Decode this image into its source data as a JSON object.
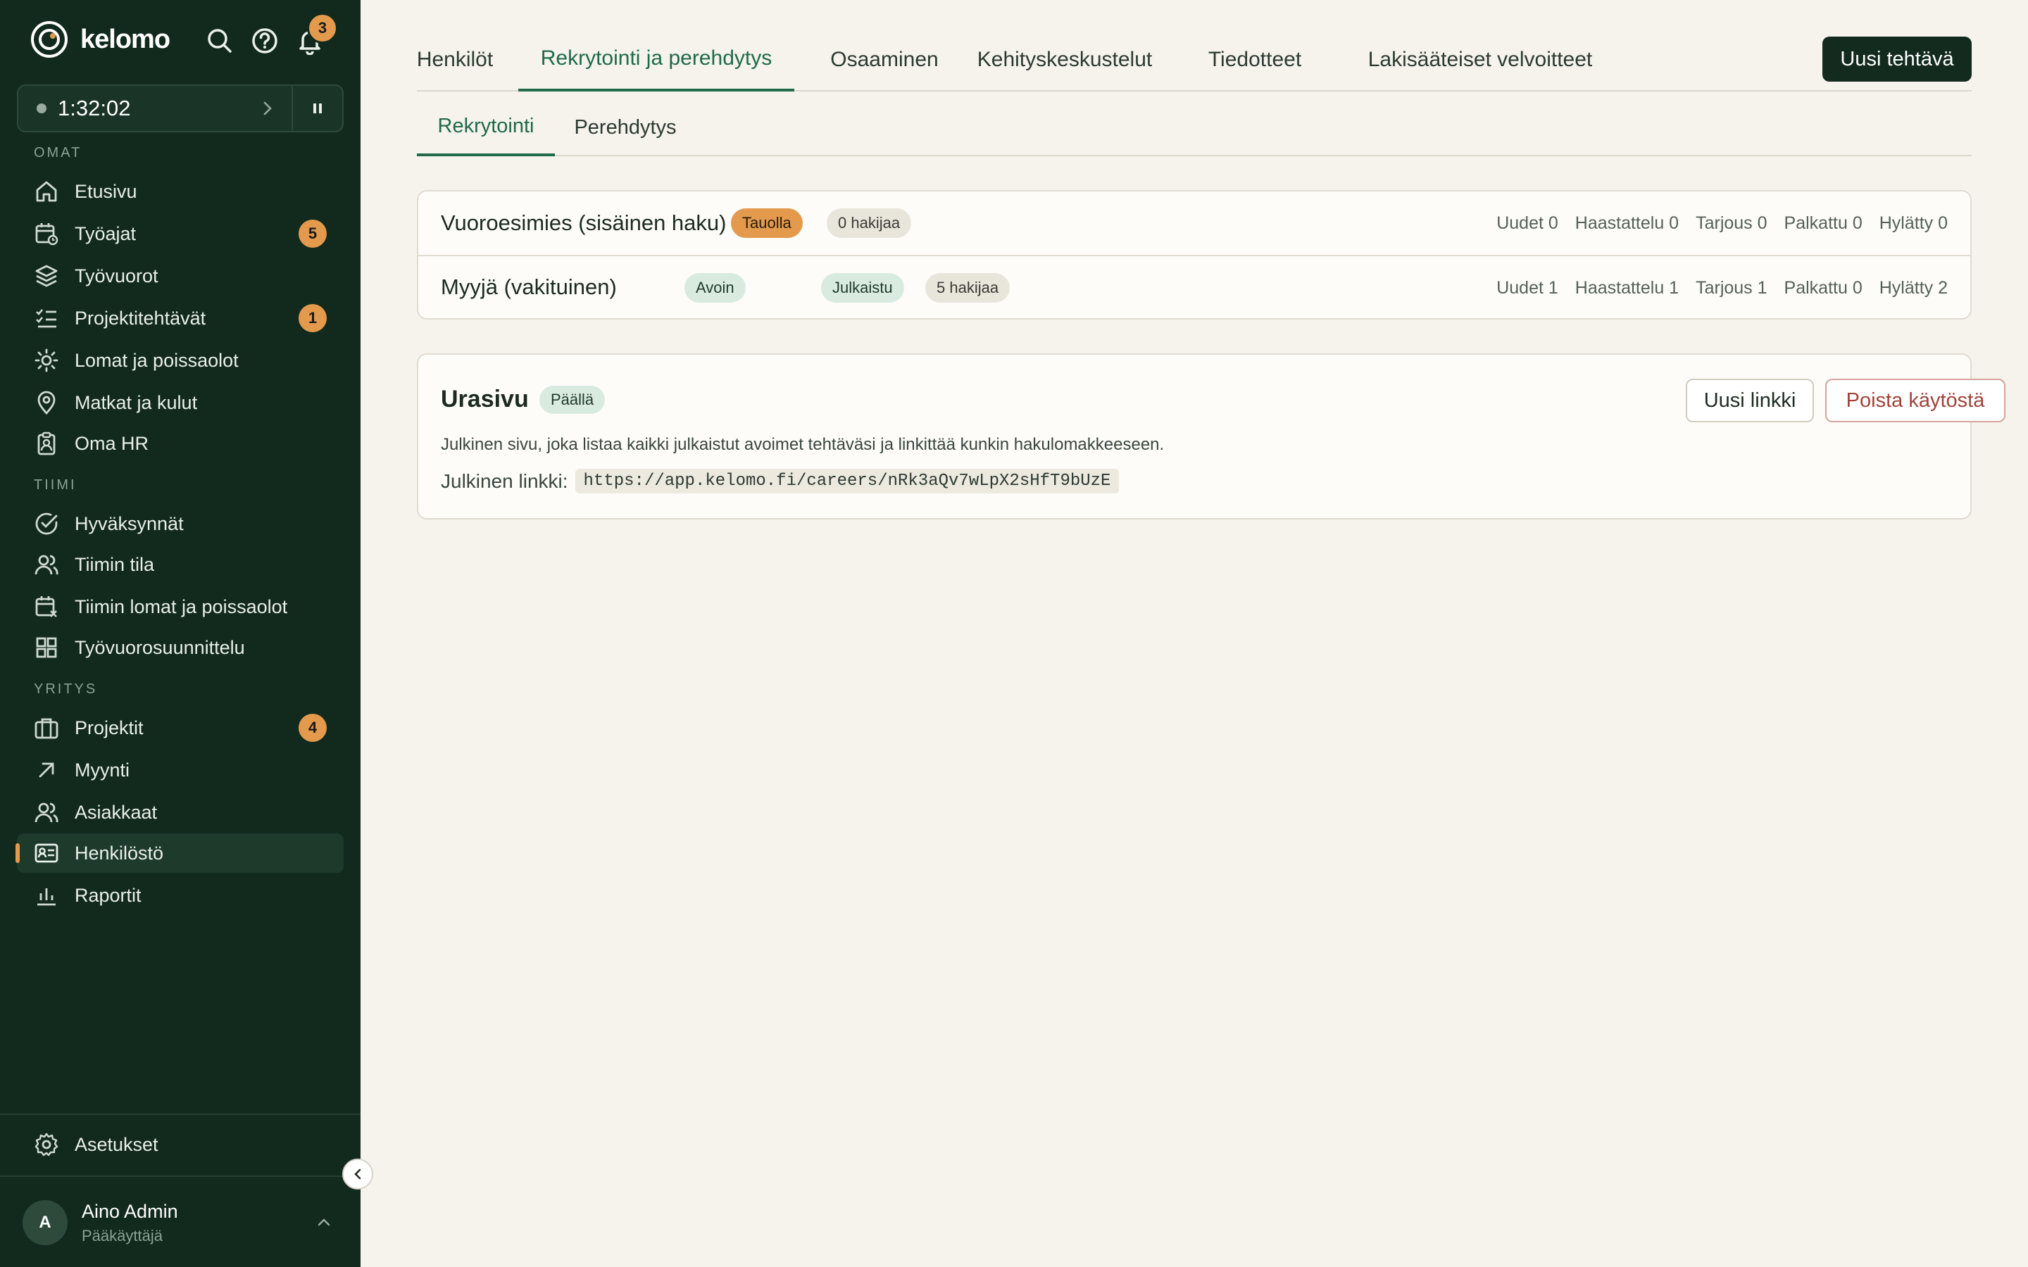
{
  "brand": {
    "name": "kelomo"
  },
  "header_icons": {
    "search": "search-icon",
    "help": "help-icon",
    "notifications": "bell-icon",
    "notification_count": "3"
  },
  "timer": {
    "time": "1:32:02"
  },
  "sections": {
    "omat": "OMAT",
    "tiimi": "TIIMI",
    "yritys": "YRITYS"
  },
  "nav": {
    "etusivu": "Etusivu",
    "tyoajat": "Työajat",
    "tyoajat_badge": "5",
    "tyovuorot": "Työvuorot",
    "projektitehtavat": "Projektitehtävät",
    "projektitehtavat_badge": "1",
    "lomat": "Lomat ja poissaolot",
    "matkat": "Matkat ja kulut",
    "omahr": "Oma HR",
    "hyvaksynnat": "Hyväksynnät",
    "tiimin_tila": "Tiimin tila",
    "tiimin_lomat": "Tiimin lomat ja poissaolot",
    "tyovuorosuunnittelu": "Työvuorosuunnittelu",
    "projektit": "Projektit",
    "projektit_badge": "4",
    "myynti": "Myynti",
    "asiakkaat": "Asiakkaat",
    "henkilosto": "Henkilöstö",
    "raportit": "Raportit",
    "asetukset": "Asetukset"
  },
  "user": {
    "initial": "A",
    "name": "Aino Admin",
    "role": "Pääkäyttäjä"
  },
  "tabs": [
    {
      "label": "Henkilöt"
    },
    {
      "label": "Rekrytointi ja perehdytys"
    },
    {
      "label": "Osaaminen"
    },
    {
      "label": "Kehityskeskustelut"
    },
    {
      "label": "Tiedotteet"
    },
    {
      "label": "Lakisääteiset velvoitteet"
    }
  ],
  "primary_action": "Uusi tehtävä",
  "subtabs": [
    {
      "label": "Rekrytointi"
    },
    {
      "label": "Perehdytys"
    }
  ],
  "jobs": [
    {
      "title": "Vuoroesimies (sisäinen haku)",
      "status": "Tauolla",
      "applicants": "0 hakijaa",
      "stats": [
        "Uudet 0",
        "Haastattelu 0",
        "Tarjous 0",
        "Palkattu 0",
        "Hylätty 0"
      ]
    },
    {
      "title": "Myyjä (vakituinen)",
      "status": "Avoin",
      "published": "Julkaistu",
      "applicants": "5 hakijaa",
      "stats": [
        "Uudet 1",
        "Haastattelu 1",
        "Tarjous 1",
        "Palkattu 0",
        "Hylätty 2"
      ]
    }
  ],
  "career": {
    "title": "Urasivu",
    "status": "Päällä",
    "new_link": "Uusi linkki",
    "disable": "Poista käytöstä",
    "description": "Julkinen sivu, joka listaa kaikki julkaistut avoimet tehtäväsi ja linkittää kunkin hakulomakkeeseen.",
    "link_label": "Julkinen linkki:",
    "link_url": "https://app.kelomo.fi/careers/nRk3aQv7wLpX2sHfT9bUzE"
  },
  "colors": {
    "sidebar_bg": "#122a1e",
    "accent_orange": "#e39a4c",
    "accent_green": "#1f6b47",
    "page_bg": "#f5f3ec",
    "danger": "#a0443a"
  }
}
